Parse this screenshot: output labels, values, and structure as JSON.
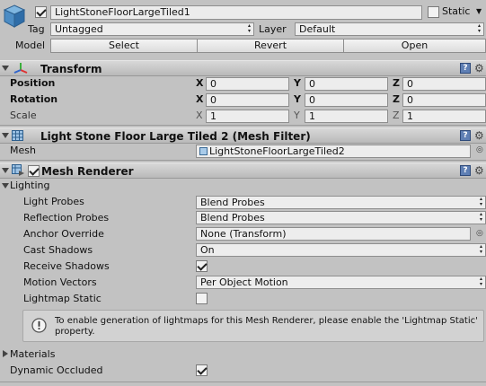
{
  "object": {
    "name": "LightStoneFloorLargeTiled1",
    "active": true,
    "static_label": "Static",
    "static_checked": false,
    "tag_label": "Tag",
    "tag_value": "Untagged",
    "layer_label": "Layer",
    "layer_value": "Default",
    "model_label": "Model",
    "model_buttons": [
      "Select",
      "Revert",
      "Open"
    ]
  },
  "transform": {
    "title": "Transform",
    "position_label": "Position",
    "rotation_label": "Rotation",
    "scale_label": "Scale",
    "axes": [
      "X",
      "Y",
      "Z"
    ],
    "position": [
      "0",
      "0",
      "0"
    ],
    "rotation": [
      "0",
      "0",
      "0"
    ],
    "scale": [
      "1",
      "1",
      "1"
    ]
  },
  "mesh_filter": {
    "title": "Light Stone Floor Large Tiled 2 (Mesh Filter)",
    "mesh_label": "Mesh",
    "mesh_value": "LightStoneFloorLargeTiled2"
  },
  "mesh_renderer": {
    "title": "Mesh Renderer",
    "enabled": true,
    "lighting_label": "Lighting",
    "light_probes_label": "Light Probes",
    "light_probes_value": "Blend Probes",
    "reflection_probes_label": "Reflection Probes",
    "reflection_probes_value": "Blend Probes",
    "anchor_override_label": "Anchor Override",
    "anchor_override_value": "None (Transform)",
    "cast_shadows_label": "Cast Shadows",
    "cast_shadows_value": "On",
    "receive_shadows_label": "Receive Shadows",
    "receive_shadows_checked": true,
    "motion_vectors_label": "Motion Vectors",
    "motion_vectors_value": "Per Object Motion",
    "lightmap_static_label": "Lightmap Static",
    "lightmap_static_checked": false,
    "info_line1": "To enable generation of lightmaps for this Mesh Renderer, please enable the 'Lightmap Static'",
    "info_line2": "property.",
    "materials_label": "Materials",
    "dynamic_occluded_label": "Dynamic Occluded",
    "dynamic_occluded_checked": true
  },
  "colors": {
    "background": "#c2c2c2",
    "help_icon": "#5f7fb4"
  }
}
